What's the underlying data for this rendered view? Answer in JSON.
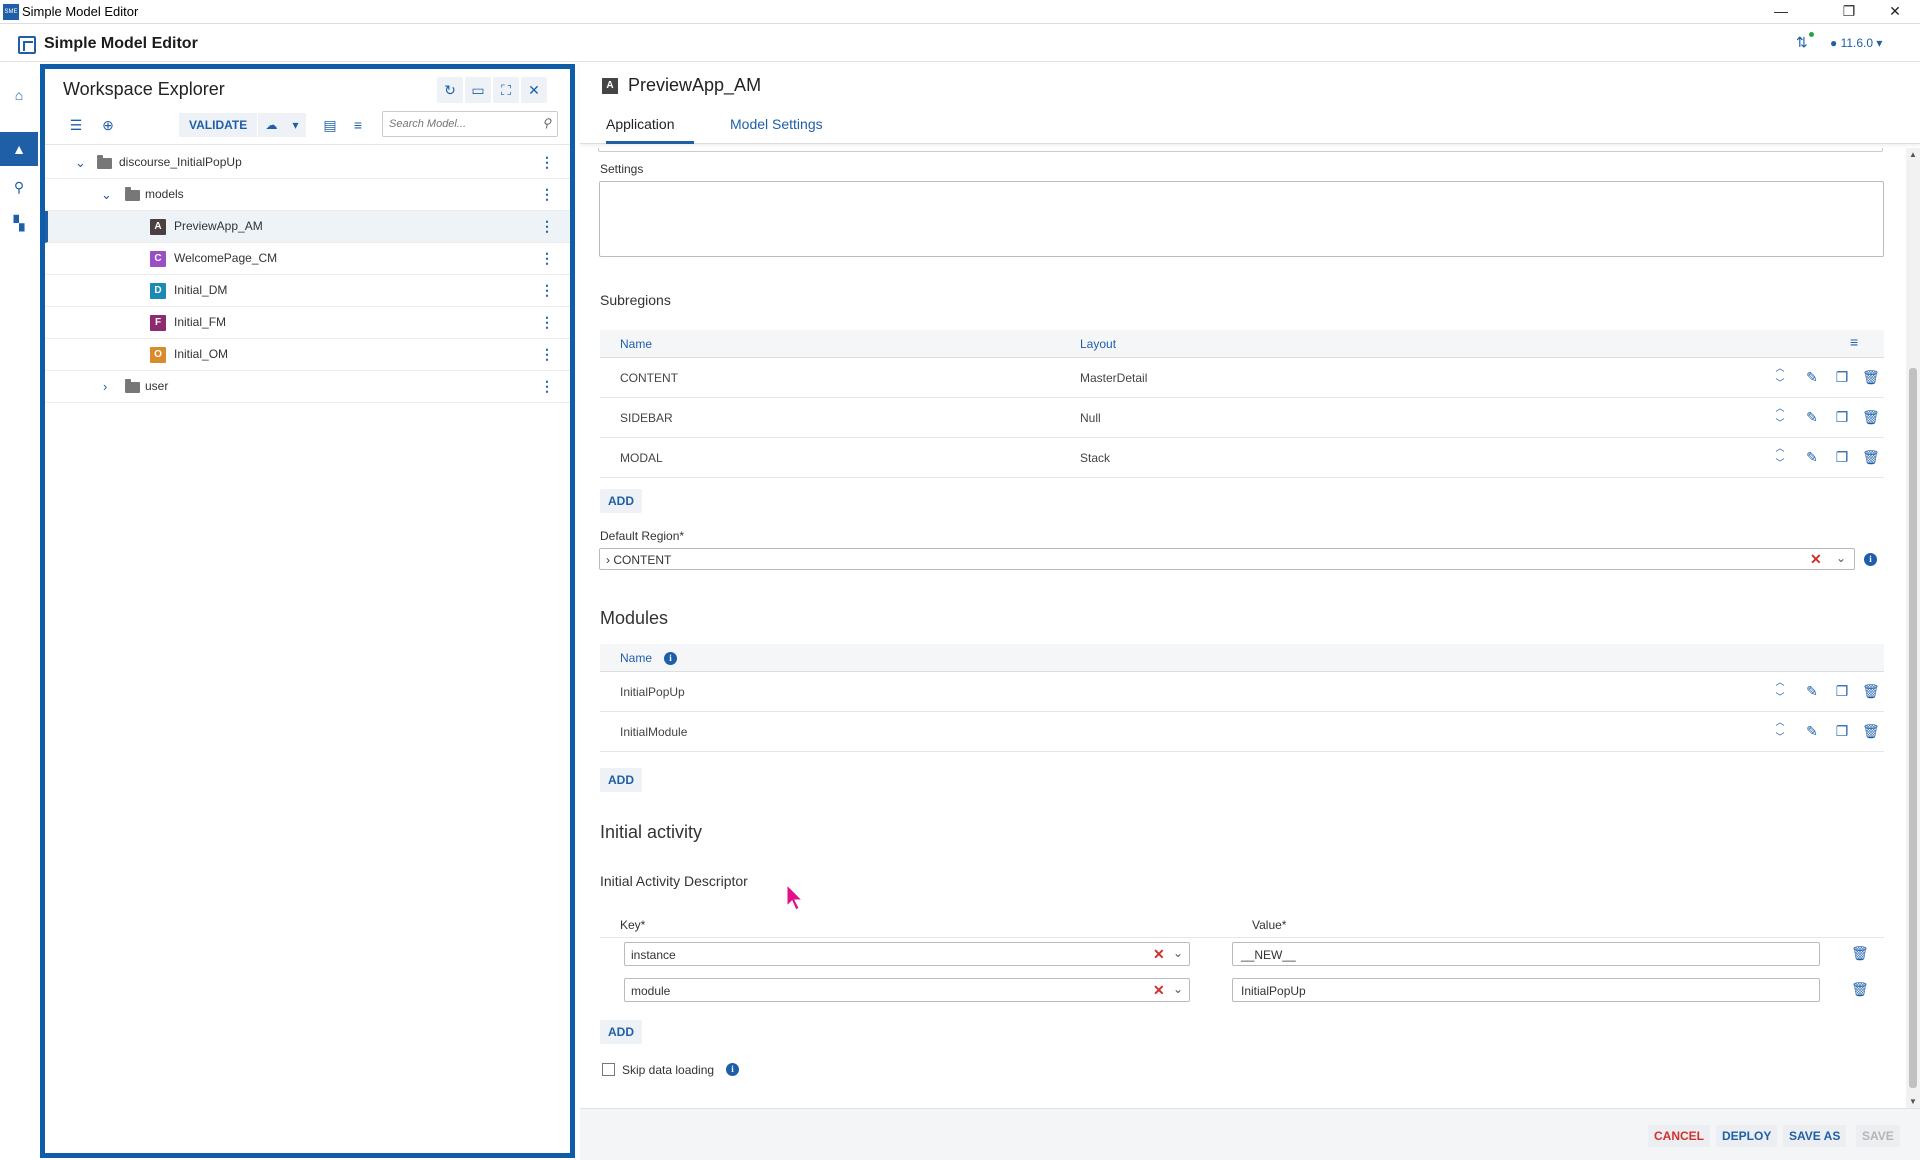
{
  "window": {
    "title": "Simple Model Editor",
    "controls": {
      "minimize": "—",
      "restore": "❐",
      "close": "✕"
    }
  },
  "app": {
    "title": "Simple Model Editor",
    "version": "11.6.0"
  },
  "nav": [
    {
      "icon": "home-icon",
      "glyph": "⌂"
    },
    {
      "icon": "application-icon",
      "glyph": "▲"
    },
    {
      "icon": "search-icon",
      "glyph": "⚲"
    },
    {
      "icon": "hierarchy-icon",
      "glyph": "▚"
    }
  ],
  "explorer": {
    "title": "Workspace Explorer",
    "validate_label": "VALIDATE",
    "search_placeholder": "Search Model...",
    "tree": [
      {
        "label": "discourse_InitialPopUp",
        "type": "folder",
        "expanded": true
      },
      {
        "label": "models",
        "type": "folder",
        "expanded": true
      },
      {
        "label": "PreviewApp_AM",
        "badge": "A",
        "badge_color": "#4a4040",
        "selected": true
      },
      {
        "label": "WelcomePage_CM",
        "badge": "C",
        "badge_color": "#9b4fc4"
      },
      {
        "label": "Initial_DM",
        "badge": "D",
        "badge_color": "#1b8ab4"
      },
      {
        "label": "Initial_FM",
        "badge": "F",
        "badge_color": "#8e2a6e"
      },
      {
        "label": "Initial_OM",
        "badge": "O",
        "badge_color": "#d98a2a"
      },
      {
        "label": "user",
        "type": "folder",
        "expanded": false
      }
    ]
  },
  "editor": {
    "badge": "A",
    "title": "PreviewApp_AM",
    "tabs": [
      {
        "label": "Application",
        "active": true
      },
      {
        "label": "Model Settings",
        "active": false
      }
    ],
    "settings_label": "Settings",
    "subregions": {
      "heading": "Subregions",
      "columns": [
        "Name",
        "Layout"
      ],
      "rows": [
        {
          "name": "CONTENT",
          "layout": "MasterDetail"
        },
        {
          "name": "SIDEBAR",
          "layout": "Null"
        },
        {
          "name": "MODAL",
          "layout": "Stack"
        }
      ],
      "add_label": "ADD"
    },
    "default_region": {
      "label": "Default Region*",
      "value": "› CONTENT"
    },
    "modules": {
      "heading": "Modules",
      "column": "Name",
      "rows": [
        "InitialPopUp",
        "InitialModule"
      ],
      "add_label": "ADD"
    },
    "initial_activity": {
      "heading": "Initial activity",
      "descriptor_label": "Initial Activity Descriptor",
      "columns": [
        "Key*",
        "Value*"
      ],
      "rows": [
        {
          "key": "instance",
          "value": "__NEW__"
        },
        {
          "key": "module",
          "value": "InitialPopUp"
        }
      ],
      "add_label": "ADD"
    },
    "skip_data_loading_label": "Skip data loading",
    "skip_data_loading_checked": false
  },
  "footer": {
    "cancel": "CANCEL",
    "deploy": "DEPLOY",
    "save_as": "SAVE AS",
    "save": "SAVE"
  },
  "colors": {
    "accent": "#1f5fa8",
    "danger": "#d0312d",
    "disabled": "#b5b5b5",
    "cursor": "#e0118a"
  }
}
